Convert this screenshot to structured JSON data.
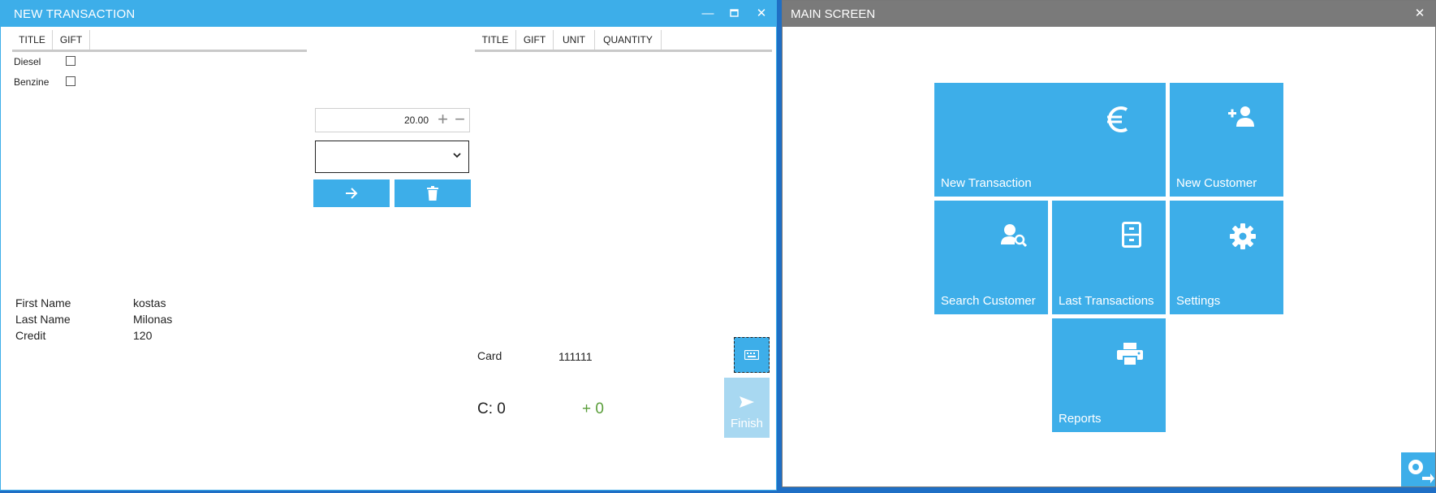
{
  "transaction_window": {
    "title": "NEW TRANSACTION",
    "controls": {
      "minimize": "—",
      "maximize": "▫",
      "close": "✕"
    },
    "products_table": {
      "columns": [
        "TITLE",
        "GIFT"
      ],
      "rows": [
        {
          "title": "Diesel",
          "gift": false
        },
        {
          "title": "Benzine",
          "gift": false
        }
      ]
    },
    "cart_table": {
      "columns": [
        "TITLE",
        "GIFT",
        "UNIT",
        "QUANTITY"
      ],
      "rows": []
    },
    "quantity": {
      "value": "20.00",
      "plus": "+",
      "minus": "−"
    },
    "select": {
      "value": ""
    },
    "customer": {
      "first_name_label": "First Name",
      "first_name": "kostas",
      "last_name_label": "Last Name",
      "last_name": "Milonas",
      "credit_label": "Credit",
      "credit": "120"
    },
    "card": {
      "label": "Card",
      "value": "111111"
    },
    "credit_used": "C: 0",
    "credit_gain": "+ 0",
    "finish_label": "Finish"
  },
  "main_window": {
    "title": "MAIN SCREEN",
    "close": "✕",
    "tiles": [
      {
        "label": "New Transaction",
        "icon": "euro-icon"
      },
      {
        "label": "New Customer",
        "icon": "add-user-icon"
      },
      {
        "label": "Search Customer",
        "icon": "search-user-icon"
      },
      {
        "label": "Last Transactions",
        "icon": "archive-icon"
      },
      {
        "label": "Settings",
        "icon": "gear-icon"
      },
      {
        "label": "Reports",
        "icon": "printer-icon"
      }
    ]
  },
  "colors": {
    "accent": "#3daee9",
    "titlebar_inactive": "#7a7a7a",
    "credit_gain": "#5a9e3a",
    "finish_disabled": "#a8d8f1"
  }
}
